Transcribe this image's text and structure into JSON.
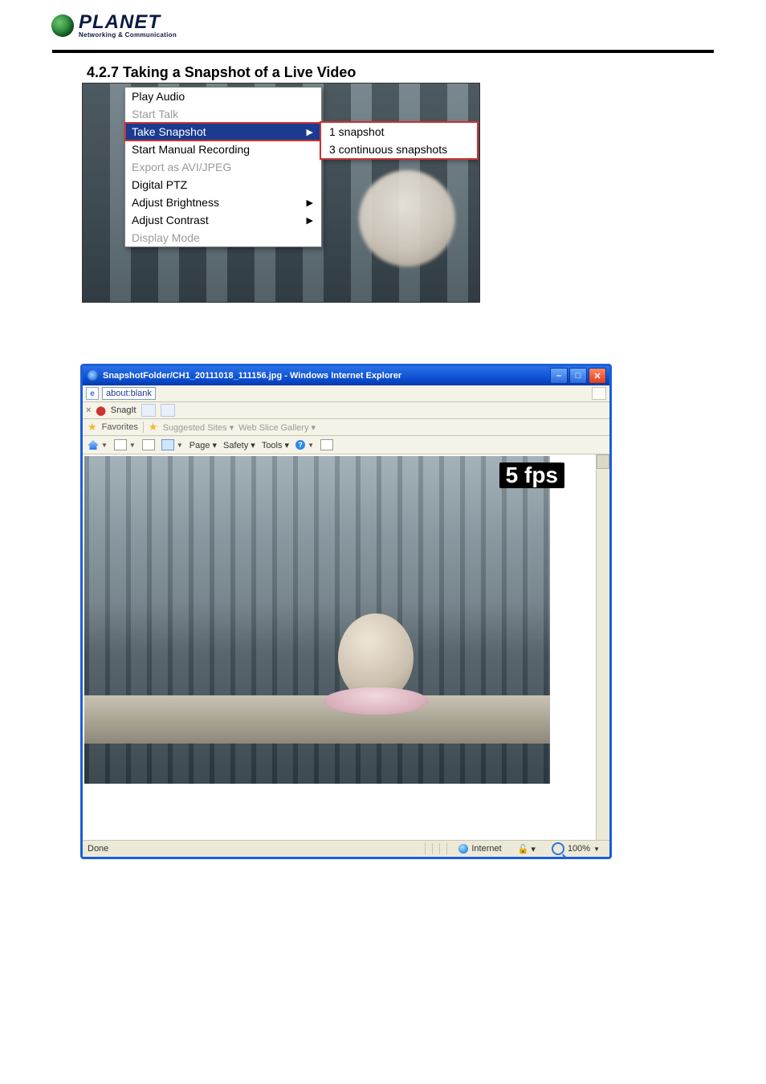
{
  "logo": {
    "brand": "PLANET",
    "tagline": "Networking & Communication"
  },
  "heading": "4.2.7 Taking a Snapshot of a Live Video",
  "context_menu": {
    "items": [
      {
        "label": "Play Audio",
        "disabled": false,
        "submenu": false
      },
      {
        "label": "Start Talk",
        "disabled": true,
        "submenu": false
      },
      {
        "label": "Take Snapshot",
        "disabled": false,
        "submenu": true,
        "highlight": true
      },
      {
        "label": "Start Manual Recording",
        "disabled": false,
        "submenu": false
      },
      {
        "label": "Export as AVI/JPEG",
        "disabled": true,
        "submenu": false
      },
      {
        "label": "Digital PTZ",
        "disabled": false,
        "submenu": false
      },
      {
        "label": "Adjust Brightness",
        "disabled": false,
        "submenu": true
      },
      {
        "label": "Adjust Contrast",
        "disabled": false,
        "submenu": true
      },
      {
        "label": "Display Mode",
        "disabled": true,
        "submenu": false
      }
    ],
    "snapshot_submenu": [
      "1 snapshot",
      "3 continuous snapshots"
    ]
  },
  "ie": {
    "title": "SnapshotFolder/CH1_20111018_111156.jpg - Windows Internet Explorer",
    "address": "about:blank",
    "snagit_label": "SnagIt",
    "favorites_label": "Favorites",
    "suggested_sites": "Suggested Sites ▾",
    "web_slice": "Web Slice Gallery ▾",
    "menus": {
      "page": "Page ▾",
      "safety": "Safety ▾",
      "tools": "Tools ▾"
    },
    "fps_overlay": "5 fps",
    "status_done": "Done",
    "status_zone": "Internet",
    "zoom": "100%"
  }
}
